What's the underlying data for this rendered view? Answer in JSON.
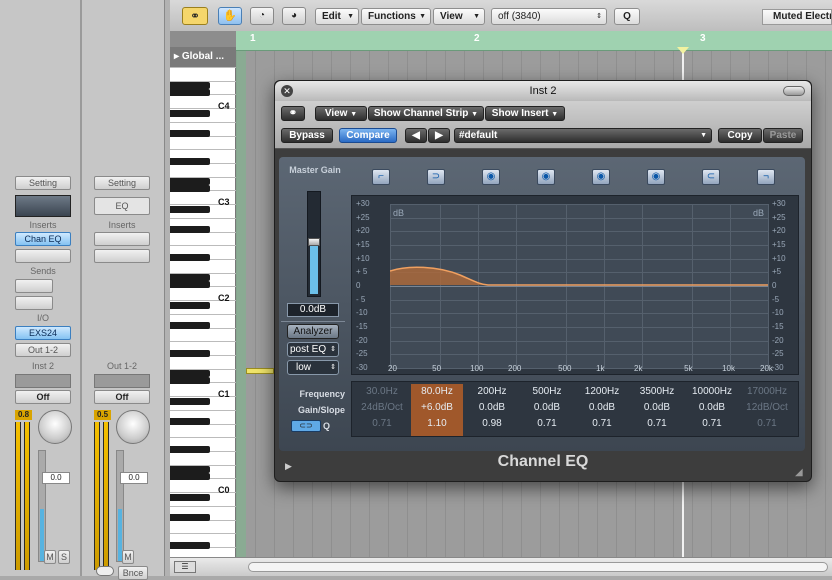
{
  "toolbar": {
    "edit": "Edit",
    "functions": "Functions",
    "view": "View",
    "midi_value": "off (3840)",
    "q": "Q",
    "track_name": "Muted Electr"
  },
  "arrange": {
    "global_tracks": "Global ...",
    "bars": [
      "1",
      "2",
      "3"
    ],
    "octaves": [
      "C4",
      "C3",
      "C2",
      "C1",
      "C0"
    ]
  },
  "mixer": {
    "strip1": {
      "setting": "Setting",
      "inserts_label": "Inserts",
      "insert1": "Chan EQ",
      "sends_label": "Sends",
      "io_label": "I/O",
      "input": "EXS24",
      "output": "Out 1-2",
      "name": "Inst 2",
      "automation": "Off",
      "peak": "0.8",
      "volume": "0.0",
      "mute": "M",
      "solo": "S"
    },
    "strip2": {
      "setting": "Setting",
      "eq": "EQ",
      "inserts_label": "Inserts",
      "name": "Out 1-2",
      "automation": "Off",
      "peak": "0.5",
      "volume": "0.0",
      "mute": "M",
      "bounce": "Bnce"
    }
  },
  "plugin": {
    "title": "Inst 2",
    "view_menu": "View",
    "show_channel_strip": "Show Channel Strip",
    "show_insert": "Show Insert",
    "bypass": "Bypass",
    "compare": "Compare",
    "preset": "#default",
    "copy": "Copy",
    "paste": "Paste",
    "master_gain_label": "Master Gain",
    "master_gain_value": "0.0dB",
    "analyzer": "Analyzer",
    "analyzer_mode": "post EQ",
    "analyzer_res": "low",
    "db_unit": "dB",
    "db_scale_left": [
      "+30",
      "+25",
      "+20",
      "+15",
      "+10",
      "+ 5",
      "0",
      "- 5",
      "-10",
      "-15",
      "-20",
      "-25",
      "-30"
    ],
    "db_scale_right": [
      "+30",
      "+25",
      "+20",
      "+15",
      "+10",
      "+5",
      "0",
      "-5",
      "-10",
      "-15",
      "-20",
      "-25",
      "-30"
    ],
    "freq_axis": [
      "20",
      "50",
      "100",
      "200",
      "500",
      "1k",
      "2k",
      "5k",
      "10k",
      "20k"
    ],
    "param_labels": {
      "frequency": "Frequency",
      "gain_slope": "Gain/Slope",
      "q": "Q"
    },
    "bands": [
      {
        "freq": "30.0Hz",
        "gain": "24dB/Oct",
        "q": "0.71",
        "state": "off"
      },
      {
        "freq": "80.0Hz",
        "gain": "+6.0dB",
        "q": "1.10",
        "state": "selected"
      },
      {
        "freq": "200Hz",
        "gain": "0.0dB",
        "q": "0.98",
        "state": "on"
      },
      {
        "freq": "500Hz",
        "gain": "0.0dB",
        "q": "0.71",
        "state": "on"
      },
      {
        "freq": "1200Hz",
        "gain": "0.0dB",
        "q": "0.71",
        "state": "on"
      },
      {
        "freq": "3500Hz",
        "gain": "0.0dB",
        "q": "0.71",
        "state": "on"
      },
      {
        "freq": "10000Hz",
        "gain": "0.0dB",
        "q": "0.71",
        "state": "on"
      },
      {
        "freq": "17000Hz",
        "gain": "12dB/Oct",
        "q": "0.71",
        "state": "off"
      }
    ],
    "footer_name": "Channel EQ"
  }
}
